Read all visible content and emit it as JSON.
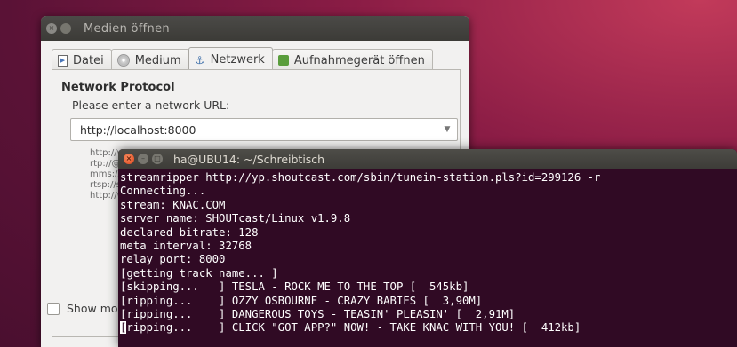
{
  "dialog": {
    "title": "Medien öffnen",
    "tabs": [
      {
        "label": "Datei"
      },
      {
        "label": "Medium"
      },
      {
        "label": "Netzwerk"
      },
      {
        "label": "Aufnahmegerät öffnen"
      }
    ],
    "section_title": "Network Protocol",
    "url_prompt": "Please enter a network URL:",
    "url_value": "http://localhost:8000",
    "examples": [
      "http://w",
      "rtp://@:",
      "mms://",
      "rtsp://se",
      "http://w"
    ],
    "show_more_label": "Show mor"
  },
  "terminal": {
    "title": "ha@UBU14: ~/Schreibtisch",
    "lines": [
      "streamripper http://yp.shoutcast.com/sbin/tunein-station.pls?id=299126 -r",
      "Connecting...",
      "stream: KNAC.COM",
      "server name: SHOUTcast/Linux v1.9.8",
      "declared bitrate: 128",
      "meta interval: 32768",
      "relay port: 8000",
      "[getting track name... ]",
      "[skipping...   ] TESLA - ROCK ME TO THE TOP [  545kb]",
      "[ripping...    ] OZZY OSBOURNE - CRAZY BABIES [  3,90M]",
      "[ripping...    ] DANGEROUS TOYS - TEASIN' PLEASIN' [  2,91M]"
    ],
    "last_line_cursor": "[",
    "last_line_rest": "ripping...    ] CLICK \"GOT APP?\" NOW! - TAKE KNAC WITH YOU! [  412kb]"
  }
}
